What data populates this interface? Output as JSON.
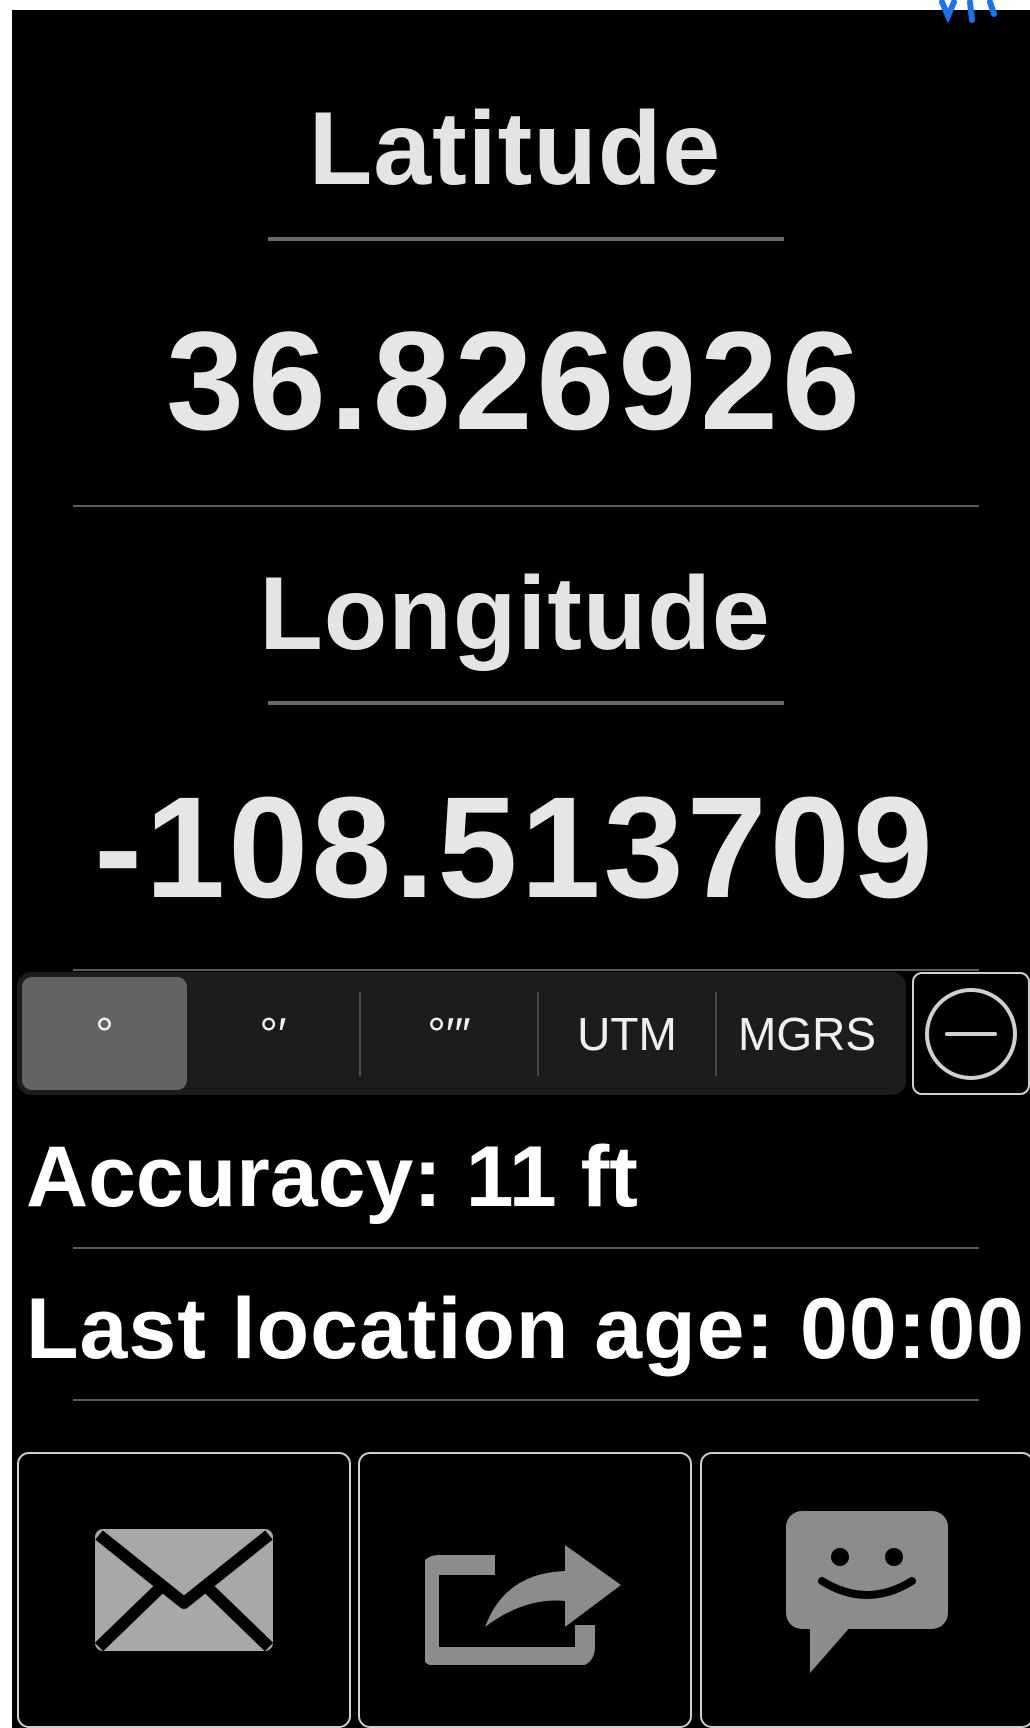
{
  "latitude": {
    "label": "Latitude",
    "value": "36.826926"
  },
  "longitude": {
    "label": "Longitude",
    "value": "-108.513709"
  },
  "format_selector": {
    "options": [
      "°",
      "°′",
      "°′″",
      "UTM",
      "MGRS"
    ],
    "selected": "°"
  },
  "accuracy_text": "Accuracy: 11 ft",
  "age_text": "Last location age: 00:00",
  "actions": {
    "email_icon": "envelope-icon",
    "share_icon": "share-icon",
    "message_icon": "message-icon"
  },
  "colors": {
    "background": "#000000",
    "text": "#e6e6e6",
    "segment_bg": "#1c1c1e",
    "segment_selected": "#636366",
    "icon_gray": "#a8a8a8",
    "status_blue": "#1a73e8"
  }
}
